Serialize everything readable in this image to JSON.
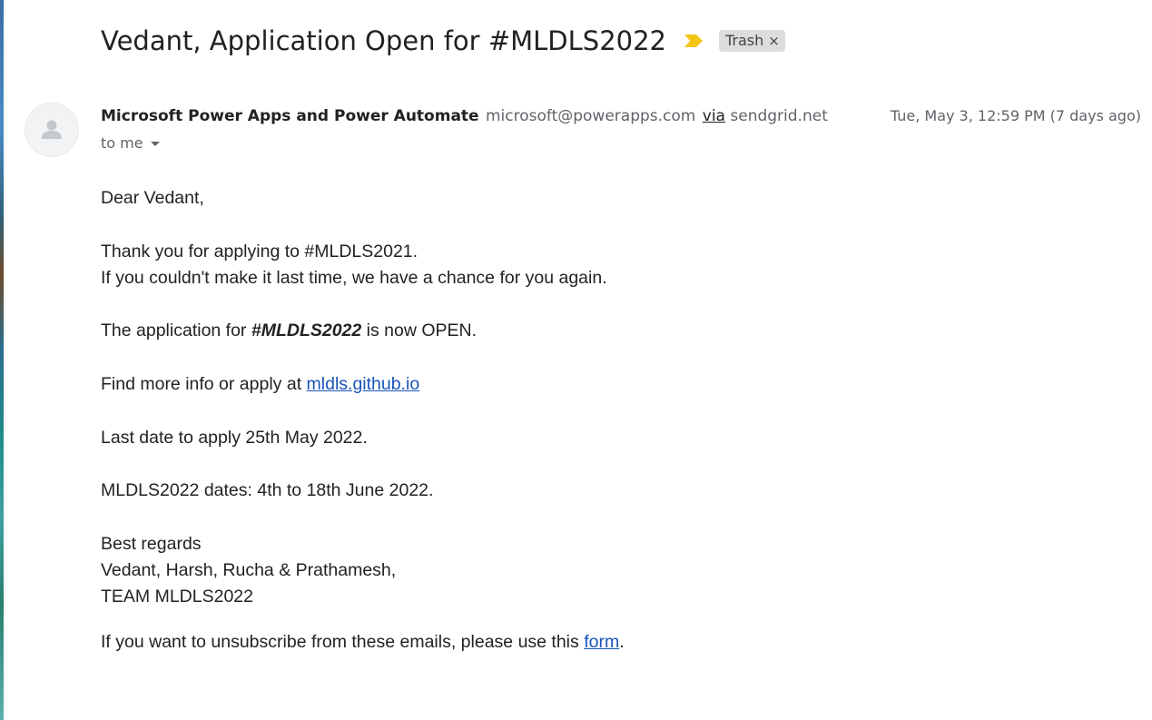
{
  "email": {
    "subject": "Vedant, Application Open for #MLDLS2022",
    "label": "Trash",
    "label_remove": "×",
    "sender_name": "Microsoft Power Apps and Power Automate",
    "sender_email": "microsoft@powerapps.com",
    "via_label": "via",
    "via_domain": "sendgrid.net",
    "date": "Tue, May 3, 12:59 PM (7 days ago)",
    "recipient": "to me"
  },
  "body": {
    "greeting": "Dear  Vedant,",
    "thanks": "Thank you for applying to #MLDLS2021.",
    "chance": "If you couldn't make it last time, we have a chance for you again.",
    "open_prefix": "The application for ",
    "open_highlight": "#MLDLS2022",
    "open_suffix": " is now OPEN.",
    "info_prefix": "Find more info or apply at ",
    "info_link": "mldls.github.io",
    "last_date": "Last date to apply 25th May 2022.",
    "dates": "MLDLS2022 dates: 4th to 18th June 2022.",
    "regards": "Best regards",
    "names": "Vedant, Harsh, Rucha & Prathamesh,",
    "team": "TEAM MLDLS2022",
    "unsub_prefix": "If you want to unsubscribe from these emails, please use this ",
    "unsub_link": "form",
    "unsub_suffix": "."
  },
  "icons": {
    "importance": "importance-marker-icon",
    "avatar": "person-icon",
    "expand": "caret-down-icon"
  },
  "colors": {
    "importance": "#f5c518",
    "link": "#1a55b8",
    "label_bg": "#dddddd"
  }
}
